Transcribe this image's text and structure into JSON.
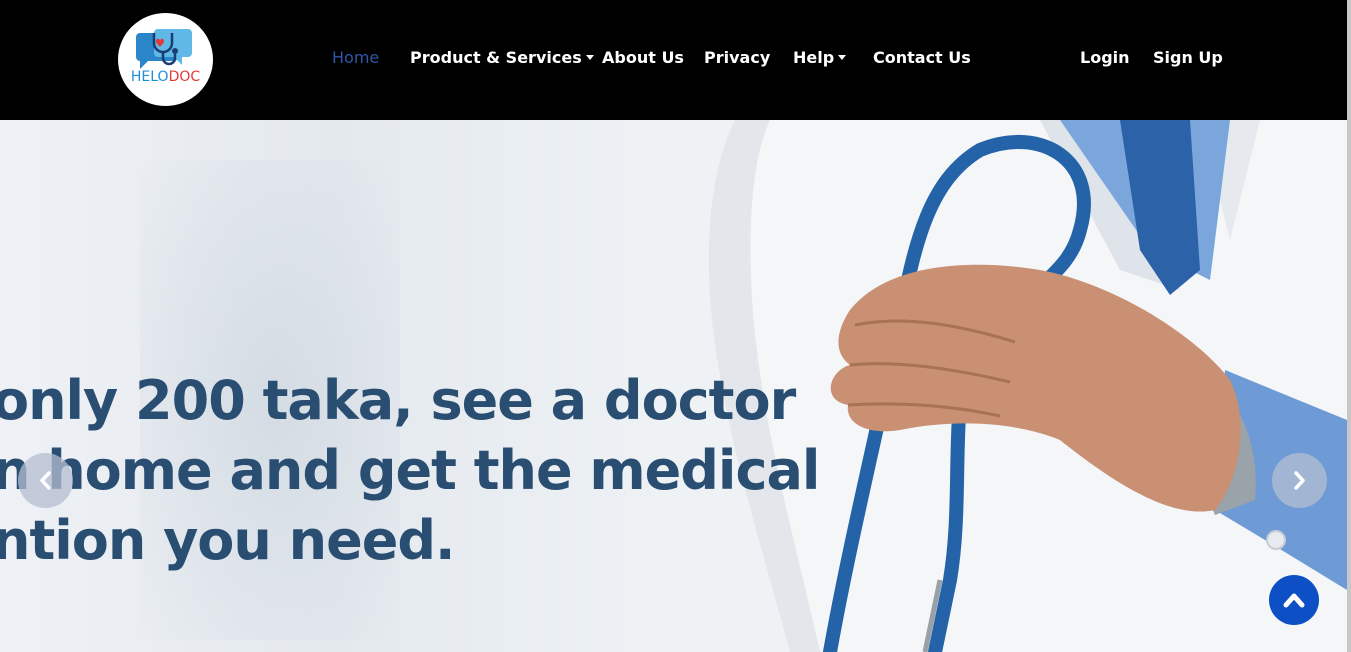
{
  "brand": {
    "logo_text_part1": "HELO",
    "logo_text_part2": "DOC",
    "primary_color": "#1f8fd6",
    "accent_color": "#e23a3a",
    "icon": "chat-stethoscope-icon"
  },
  "nav": {
    "items": [
      {
        "label": "Home",
        "active": true
      },
      {
        "label": "Product & Services",
        "dropdown": true
      },
      {
        "label": "About Us"
      },
      {
        "label": "Privacy"
      },
      {
        "label": "Help",
        "dropdown": true
      },
      {
        "label": "Contact Us"
      }
    ],
    "login_label": "Login",
    "signup_label": "Sign Up"
  },
  "hero": {
    "line1": "only 200 taka, see a doctor",
    "line2": "n home and get the medical",
    "line3": "ntion you need.",
    "text_color": "#2a4d72",
    "prev_icon": "chevron-left-icon",
    "next_icon": "chevron-right-icon"
  },
  "back_to_top": {
    "icon": "chevron-up-icon",
    "color": "#0d4fc4"
  }
}
